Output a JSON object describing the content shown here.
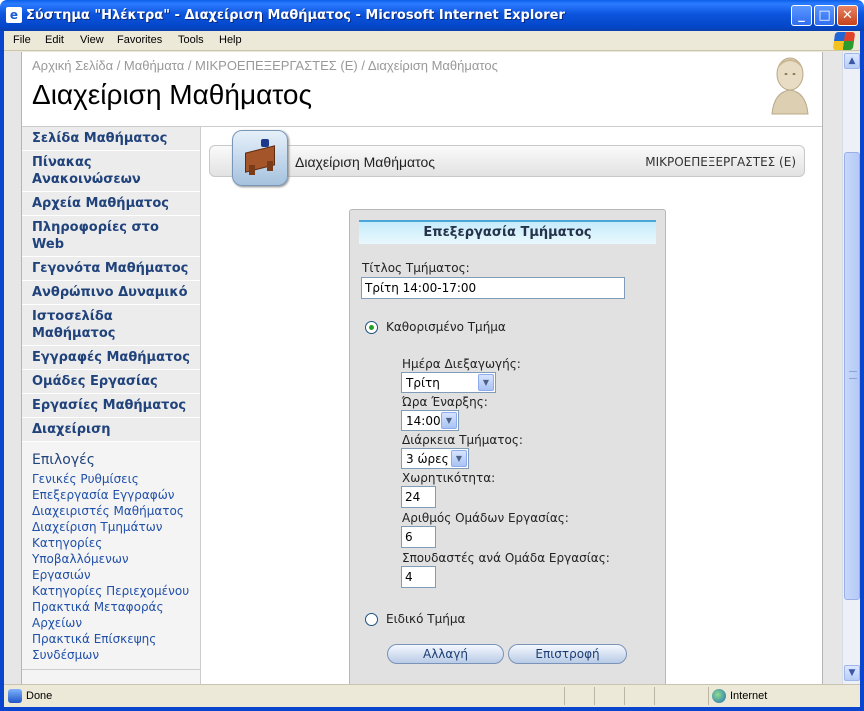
{
  "window": {
    "title": "Σύστημα \"Ηλέκτρα\" - Διαχείριση Μαθήματος - Microsoft Internet Explorer",
    "minimize": "_",
    "maximize": "□",
    "close": "✕"
  },
  "menu": [
    "File",
    "Edit",
    "View",
    "Favorites",
    "Tools",
    "Help"
  ],
  "header": {
    "breadcrumb": "Αρχική Σελίδα / Μαθήματα / ΜΙΚΡΟΕΠΕΞΕΡΓΑΣΤΕΣ (Ε) / Διαχείριση Μαθήματος",
    "title": "Διαχείριση Μαθήματος"
  },
  "nav": {
    "items": [
      "Σελίδα Μαθήματος",
      "Πίνακας Ανακοινώσεων",
      "Αρχεία Μαθήματος",
      "Πληροφορίες στο Web",
      "Γεγονότα Μαθήματος",
      "Ανθρώπινο Δυναμικό",
      "Ιστοσελίδα Μαθήματος",
      "Εγγραφές Μαθήματος",
      "Ομάδες Εργασίας",
      "Εργασίες Μαθήματος",
      "Διαχείριση"
    ],
    "options_title": "Επιλογές",
    "options": [
      "Γενικές Ρυθμίσεις",
      "Επεξεργασία Εγγραφών",
      "Διαχειριστές Μαθήματος",
      "Διαχείριση Τμημάτων",
      "Κατηγορίες Υποβαλλόμενων Εργασιών",
      "Κατηγορίες Περιεχομένου",
      "Πρακτικά Μεταφοράς Αρχείων",
      "Πρακτικά Επίσκεψης Συνδέσμων"
    ]
  },
  "toolbar": {
    "title": "Διαχείριση Μαθήματος",
    "course": "ΜΙΚΡΟΕΠΕΞΕΡΓΑΣΤΕΣ (Ε)"
  },
  "form": {
    "heading": "Επεξεργασία Τμήματος",
    "title_label": "Τίτλος Τμήματος:",
    "title_value": "Τρίτη 14:00-17:00",
    "radio_fixed": "Καθορισμένο Τμήμα",
    "day_label": "Ημέρα Διεξαγωγής:",
    "day_value": "Τρίτη",
    "start_label": "Ώρα Έναρξης:",
    "start_value": "14:00",
    "duration_label": "Διάρκεια Τμήματος:",
    "duration_value": "3 ώρες",
    "capacity_label": "Χωρητικότητα:",
    "capacity_value": "24",
    "groups_label": "Αριθμός Ομάδων Εργασίας:",
    "groups_value": "6",
    "students_label": "Σπουδαστές ανά Ομάδα Εργασίας:",
    "students_value": "4",
    "radio_special": "Ειδικό Τμήμα",
    "btn_change": "Αλλαγή",
    "btn_back": "Επιστροφή"
  },
  "status": {
    "text": "Done",
    "zone": "Internet"
  }
}
